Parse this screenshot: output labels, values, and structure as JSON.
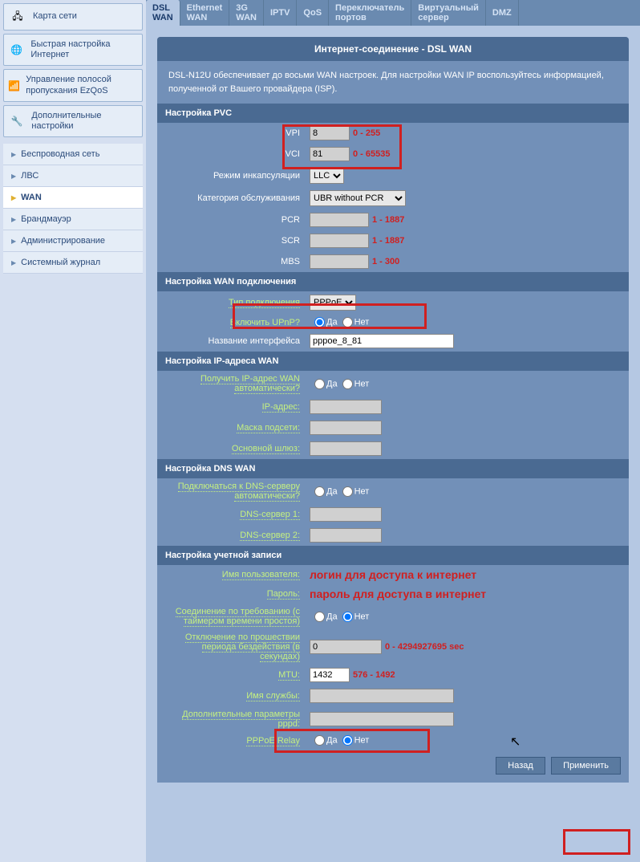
{
  "sidebar": {
    "btns": [
      {
        "label": "Карта сети",
        "icon": "🖧"
      },
      {
        "label": "Быстрая настройка Интернет",
        "icon": "🌐"
      },
      {
        "label": "Управление полосой пропускания EzQoS",
        "icon": "📶"
      },
      {
        "label": "Дополнительные настройки",
        "icon": "🔧"
      }
    ],
    "nav": [
      "Беспроводная сеть",
      "ЛВС",
      "WAN",
      "Брандмауэр",
      "Администрирование",
      "Системный журнал"
    ],
    "active": "WAN"
  },
  "tabs": [
    "DSL WAN",
    "Ethernet WAN",
    "3G WAN",
    "IPTV",
    "QoS",
    "Переключатель портов",
    "Виртуальный сервер",
    "DMZ"
  ],
  "activeTab": "DSL WAN",
  "panel": {
    "title": "Интернет-соединение - DSL WAN",
    "desc": "DSL-N12U обеспечивает до восьми WAN настроек. Для настройки WAN IP воспользуйтесь информацией, полученной от Вашего провайдера (ISP)."
  },
  "pvc": {
    "head": "Настройка PVC",
    "vpi": {
      "lbl": "VPI",
      "val": "8",
      "rng": "0 - 255"
    },
    "vci": {
      "lbl": "VCI",
      "val": "81",
      "rng": "0 - 65535"
    },
    "encap": {
      "lbl": "Режим инкапсуляции",
      "val": "LLC"
    },
    "cat": {
      "lbl": "Категория обслуживания",
      "val": "UBR without PCR"
    },
    "pcr": {
      "lbl": "PCR",
      "val": "",
      "rng": "1 - 1887"
    },
    "scr": {
      "lbl": "SCR",
      "val": "",
      "rng": "1 - 1887"
    },
    "mbs": {
      "lbl": "MBS",
      "val": "",
      "rng": "1 - 300"
    }
  },
  "wan": {
    "head": "Настройка WAN подключения",
    "type": {
      "lbl": "Тип подключения",
      "val": "PPPoE"
    },
    "upnp": {
      "lbl": "Включить UPnP?",
      "yes": "Да",
      "no": "Нет"
    },
    "iface": {
      "lbl": "Название интерфейса",
      "val": "pppoe_8_81"
    }
  },
  "ip": {
    "head": "Настройка IP-адреса WAN",
    "auto": {
      "lbl": "Получить IP-адрес WAN автоматически?",
      "yes": "Да",
      "no": "Нет"
    },
    "addr": {
      "lbl": "IP-адрес:"
    },
    "mask": {
      "lbl": "Маска подсети:"
    },
    "gw": {
      "lbl": "Основной шлюз:"
    }
  },
  "dns": {
    "head": "Настройка DNS WAN",
    "auto": {
      "lbl": "Подключаться к DNS-серверу автоматически?",
      "yes": "Да",
      "no": "Нет"
    },
    "d1": {
      "lbl": "DNS-сервер 1:"
    },
    "d2": {
      "lbl": "DNS-сервер 2:"
    }
  },
  "acct": {
    "head": "Настройка учетной записи",
    "user": {
      "lbl": "Имя пользователя:",
      "annot": "логин для доступа к интернет"
    },
    "pass": {
      "lbl": "Пароль:",
      "annot": "пароль для доступа в интернет"
    },
    "demand": {
      "lbl": "Соединение по требованию (с таймером времени простоя)",
      "yes": "Да",
      "no": "Нет"
    },
    "idle": {
      "lbl": "Отключение по прошествии периода бездействия (в секундах)",
      "val": "0",
      "rng": "0 - 4294927695 sec"
    },
    "mtu": {
      "lbl": "MTU:",
      "val": "1432",
      "rng": "576 - 1492"
    },
    "svc": {
      "lbl": "Имя службы:"
    },
    "pppd": {
      "lbl": "Дополнительные параметры pppd:"
    },
    "relay": {
      "lbl": "PPPoE Relay",
      "yes": "Да",
      "no": "Нет"
    }
  },
  "btns": {
    "back": "Назад",
    "apply": "Применить"
  }
}
